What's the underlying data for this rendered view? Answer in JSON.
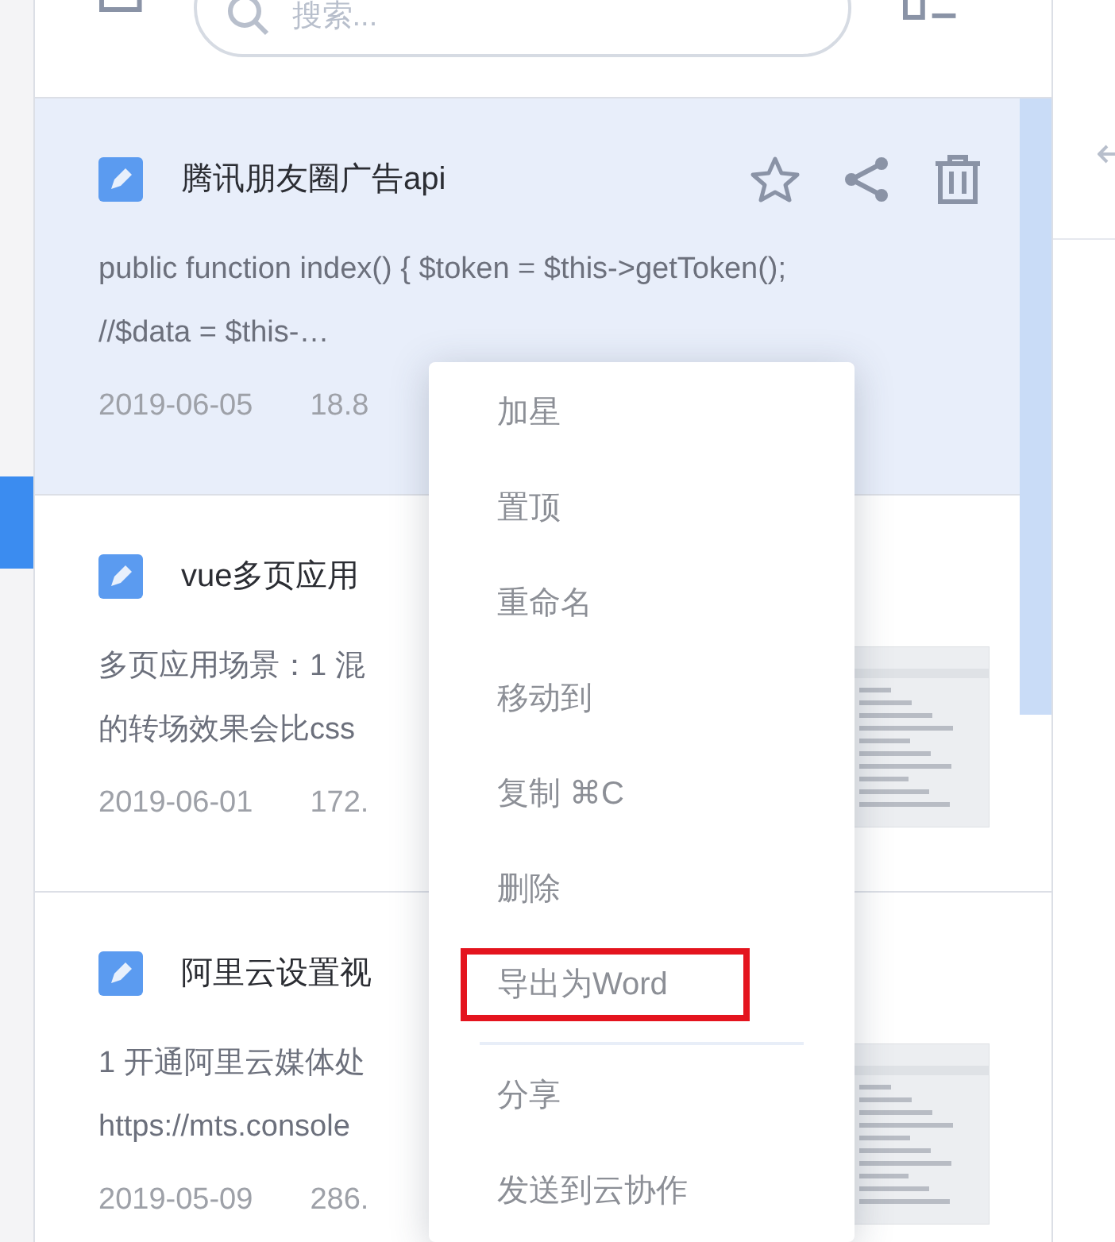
{
  "search": {
    "placeholder": "搜索..."
  },
  "notes": [
    {
      "title": "腾讯朋友圈广告api",
      "excerpt": [
        "public function index() { $token = $this->getToken();",
        "//$data = $this-…"
      ],
      "date": "2019-06-05",
      "size": "18.8",
      "selected": true
    },
    {
      "title": "vue多页应用",
      "excerpt": [
        "多页应用场景：1 混",
        "的转场效果会比css"
      ],
      "date": "2019-06-01",
      "size": "172.",
      "selected": false,
      "thumbnail": {
        "kind": "picture"
      }
    },
    {
      "title": "阿里云设置视",
      "excerpt": [
        "1 开通阿里云媒体处",
        "https://mts.console"
      ],
      "date": "2019-05-09",
      "size": "286.",
      "selected": false,
      "thumbnail": {
        "kind": "picture"
      }
    }
  ],
  "context_menu": {
    "groups": [
      [
        {
          "label": "加星",
          "highlighted": false
        },
        {
          "label": "置顶",
          "highlighted": false
        },
        {
          "label": "重命名",
          "highlighted": false
        },
        {
          "label": "移动到",
          "highlighted": false
        },
        {
          "label": "复制 ⌘C",
          "highlighted": false
        },
        {
          "label": "删除",
          "highlighted": false
        },
        {
          "label": "导出为Word",
          "highlighted": true
        }
      ],
      [
        {
          "label": "分享",
          "highlighted": false
        },
        {
          "label": "发送到云协作",
          "highlighted": false
        }
      ]
    ]
  }
}
